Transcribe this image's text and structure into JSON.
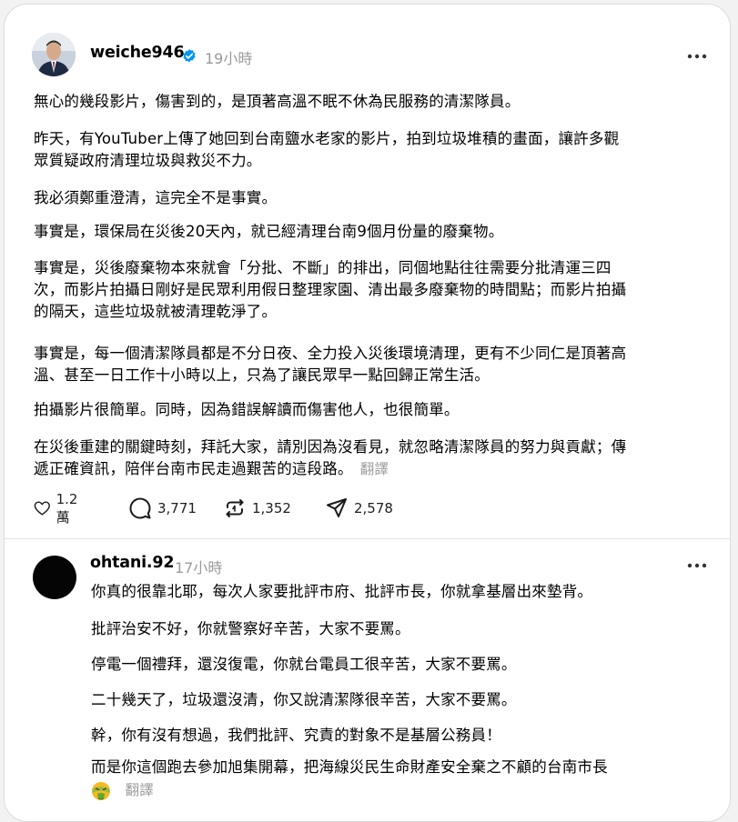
{
  "post": {
    "author": "weiche946",
    "time": "19小時",
    "paragraphs": [
      [
        "無心的幾段影片，傷害到的，是頂著高溫不眠不休為民服務的清潔隊員。"
      ],
      [
        "昨天，有YouTuber上傳了她回到台南鹽水老家的影片，拍到垃圾堆積的畫面，讓許多觀",
        "眾質疑政府清理垃圾與救災不力。"
      ],
      [
        "我必須鄭重澄清，這完全不是事實。"
      ],
      [
        "事實是，環保局在災後20天內，就已經清理台南9個月份量的廢棄物。"
      ],
      [
        "事實是，災後廢棄物本來就會「分批、不斷」的排出，同個地點往往需要分批清運三四",
        "次，而影片拍攝日剛好是民眾利用假日整理家園、清出最多廢棄物的時間點；而影片拍攝",
        "的隔天，這些垃圾就被清理乾淨了。"
      ],
      [
        "事實是，每一個清潔隊員都是不分日夜、全力投入災後環境清理，更有不少同仁是頂著高",
        "溫、甚至一日工作十小時以上，只為了讓民眾早一點回歸正常生活。"
      ],
      [
        "拍攝影片很簡單。同時，因為錯誤解讀而傷害他人，也很簡單。"
      ],
      [
        "在災後重建的關鍵時刻，拜託大家，請別因為沒看見，就忽略清潔隊員的努力與貢獻；傳",
        "遞正確資訊，陪伴台南市民走過艱苦的這段路。"
      ]
    ],
    "translate": "翻譯",
    "likes": "1.2 萬",
    "comments": "3,771",
    "reposts": "1,352",
    "shares": "2,578"
  },
  "reply": {
    "author": "ohtani.92",
    "time": "17小時",
    "lines": [
      "你真的很靠北耶，每次人家要批評市府、批評市長，你就拿基層出來墊背。",
      "批評治安不好，你就警察好辛苦，大家不要罵。",
      "停電一個禮拜，還沒復電，你就台電員工很辛苦，大家不要罵。",
      "二十幾天了，垃圾還沒清，你又說清潔隊很辛苦，大家不要罵。",
      "幹，你有沒有想過，我們批評、究責的對象不是基層公務員！",
      "而是你這個跑去參加旭集開幕，把海線災民生命財產安全棄之不顧的台南市長"
    ],
    "emoji": "vomiting-face-icon",
    "translate": "翻譯"
  },
  "colors": {
    "background": "#f2f2f2",
    "card": "#ffffff",
    "verified": "#0095f6",
    "muted": "#9a9a9a"
  }
}
